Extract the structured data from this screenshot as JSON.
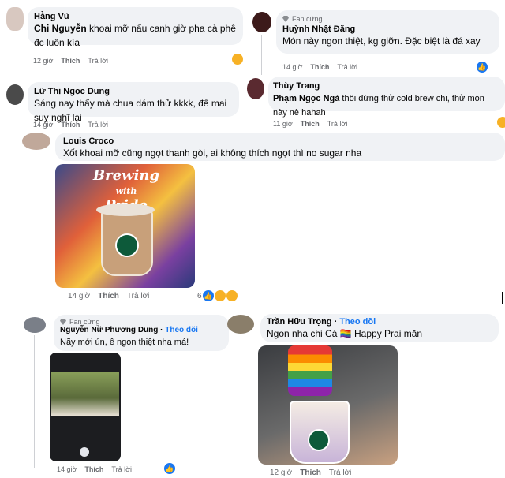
{
  "comments": [
    {
      "id": "c1",
      "name": "Hằng Vũ",
      "mention": "Chi Nguyễn",
      "text": " khoai mỡ nấu canh giờ pha cà phê đc luôn kìa",
      "time": "12 giờ",
      "like": "Thích",
      "reply": "Trả lời"
    },
    {
      "id": "c2",
      "fan_badge": "Fan cứng",
      "name": "Huỳnh Nhật Đăng",
      "text": "Món này ngon thiệt, kg giỡn. Đặc biệt là đá xay",
      "time": "14 giờ",
      "like": "Thích",
      "reply": "Trả lời"
    },
    {
      "id": "c3",
      "name": "Lữ Thị Ngọc Dung",
      "text": "Sáng nay thấy mà chua dám thử kkkk, để mai suy nghĩ lại",
      "time": "14 giờ",
      "like": "Thích",
      "reply": "Trả lời"
    },
    {
      "id": "c4",
      "name": "Thùy Trang",
      "mention": "Phạm Ngọc Ngà",
      "text": " thôi đừng thử cold brew chi, thử món này nè hahah",
      "time": "11 giờ",
      "like": "Thích",
      "reply": "Trả lời"
    },
    {
      "id": "c5",
      "name": "Louis Croco",
      "text": "Xốt khoai mỡ cũng ngọt thanh gòi, ai không thích ngọt thì no sugar nha",
      "time": "14 giờ",
      "like": "Thích",
      "reply": "Trả lời",
      "reaction_count": "6",
      "photo_text_line1": "Brewing",
      "photo_text_line2": "with",
      "photo_text_line3": "Pride"
    },
    {
      "id": "c6",
      "fan_badge": "Fan cứng",
      "name": "Nguyễn Nữ Phương Dung",
      "follow": "Theo dõi",
      "text": "Nãy mới ún, ê ngon thiệt nha má!",
      "time": "14 giờ",
      "like": "Thích",
      "reply": "Trả lời"
    },
    {
      "id": "c7",
      "name": "Trần Hữu Trọng",
      "follow": "Theo dõi",
      "text": "Ngon nha chị Cá 🏳️‍🌈 Happy Prai măn",
      "time": "12 giờ",
      "like": "Thích",
      "reply": "Trả lời"
    }
  ],
  "colors": {
    "accent": "#1877f2",
    "bubble": "#f0f2f5",
    "muted": "#65676b"
  },
  "icons": {
    "reaction_like": "like-icon",
    "reaction_haha": "haha-icon",
    "fan_badge": "gem-icon"
  }
}
